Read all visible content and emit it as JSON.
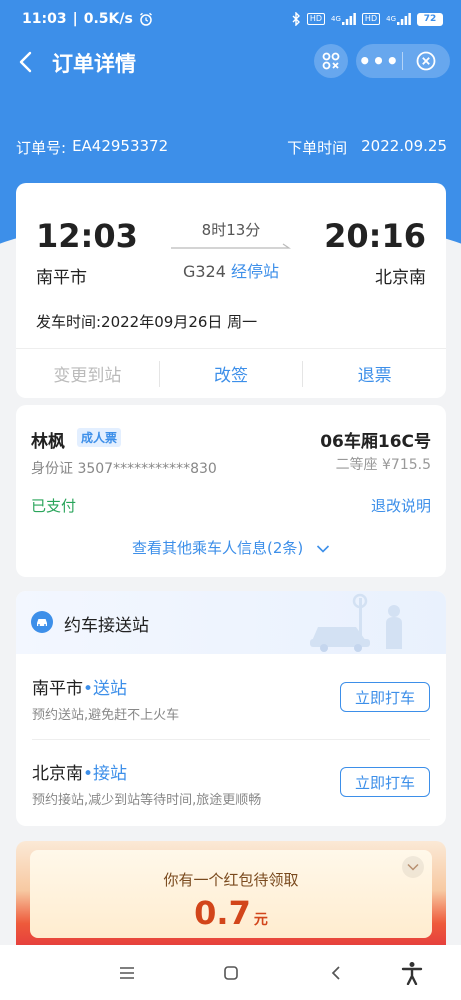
{
  "status_bar": {
    "time": "11:03",
    "speed": "0.5K/s",
    "signal1": "4G",
    "signal2": "4G",
    "hd1": "HD",
    "hd2": "HD",
    "battery": "72"
  },
  "header": {
    "title": "订单详情"
  },
  "order": {
    "number_label": "订单号:",
    "number": "EA42953372",
    "time_label": "下单时间",
    "time": "2022.09.25"
  },
  "trip": {
    "dep_time": "12:03",
    "arr_time": "20:16",
    "dep_station": "南平市",
    "arr_station": "北京南",
    "duration": "8时13分",
    "train_no": "G324",
    "stops_link": "经停站",
    "dep_date": "发车时间:2022年09月26日 周一"
  },
  "actions": {
    "change_station": "变更到站",
    "reschedule": "改签",
    "refund": "退票"
  },
  "passenger": {
    "name": "林枫",
    "ticket_type": "成人票",
    "seat": "06车厢16C号",
    "id_text": "身份证 3507***********830",
    "seat_price": "二等座 ¥715.5",
    "status": "已支付",
    "refund_rules": "退改说明",
    "more_passengers": "查看其他乘车人信息(2条)"
  },
  "pickup": {
    "title": "约车接送站",
    "items": [
      {
        "station": "南平市",
        "tag": "•送站",
        "desc": "预约送站,避免赶不上火车",
        "button": "立即打车"
      },
      {
        "station": "北京南",
        "tag": "•接站",
        "desc": "预约接站,减少到站等待时间,旅途更顺畅",
        "button": "立即打车"
      }
    ]
  },
  "red_packet": {
    "text": "你有一个红包待领取",
    "amount": "0.7",
    "unit": "元"
  },
  "colors": {
    "brand_blue": "#3d8fe9",
    "paid_green": "#2aa55b",
    "red_packet": "#e4393c"
  }
}
